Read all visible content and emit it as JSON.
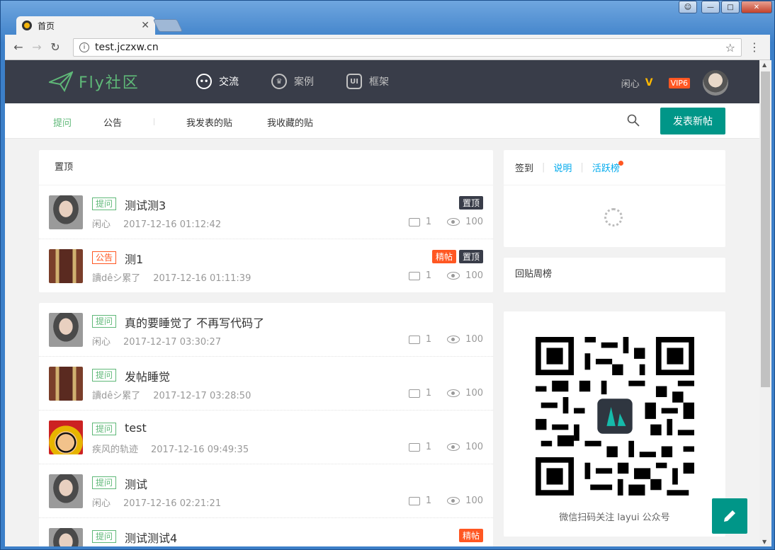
{
  "browser": {
    "tab_title": "首页",
    "url": "test.jczxw.cn"
  },
  "site": {
    "logo_text": "Fly社区",
    "nav": [
      {
        "label": "交流",
        "icon": "chat-icon"
      },
      {
        "label": "案例",
        "icon": "crown-icon"
      },
      {
        "label": "框架",
        "icon": "ui-icon"
      }
    ],
    "user": {
      "name": "闲心",
      "vip": "VIP6"
    }
  },
  "subnav": {
    "items": [
      "提问",
      "公告",
      "我发表的贴",
      "我收藏的贴"
    ],
    "post_button": "发表新帖"
  },
  "pinned": {
    "title": "置顶",
    "rows": [
      {
        "tag": "提问",
        "title": "测试测3",
        "author": "闲心",
        "time": "2017-12-16 01:12:42",
        "comments": "1",
        "views": "100",
        "badges": [
          "置顶"
        ]
      },
      {
        "tag": "公告",
        "title": "测1",
        "author": "讀dêシ累了",
        "time": "2017-12-16 01:11:39",
        "comments": "1",
        "views": "100",
        "badges": [
          "精帖",
          "置顶"
        ]
      }
    ]
  },
  "list": {
    "rows": [
      {
        "tag": "提问",
        "title": "真的要睡觉了 不再写代码了",
        "author": "闲心",
        "time": "2017-12-17 03:30:27",
        "comments": "1",
        "views": "100"
      },
      {
        "tag": "提问",
        "title": "发帖睡觉",
        "author": "讀dêシ累了",
        "time": "2017-12-17 03:28:50",
        "comments": "1",
        "views": "100"
      },
      {
        "tag": "提问",
        "title": "test",
        "author": "疾风的轨迹",
        "time": "2017-12-16 09:49:35",
        "comments": "1",
        "views": "100"
      },
      {
        "tag": "提问",
        "title": "测试",
        "author": "闲心",
        "time": "2017-12-16 02:21:21",
        "comments": "1",
        "views": "100"
      },
      {
        "tag": "提问",
        "title": "测试测试4",
        "badges": [
          "精帖"
        ]
      }
    ]
  },
  "sidebar": {
    "sign_tabs": [
      "签到",
      "说明",
      "活跃榜"
    ],
    "weekly_title": "回贴周榜",
    "qr_caption": "微信扫码关注 layui 公众号"
  }
}
